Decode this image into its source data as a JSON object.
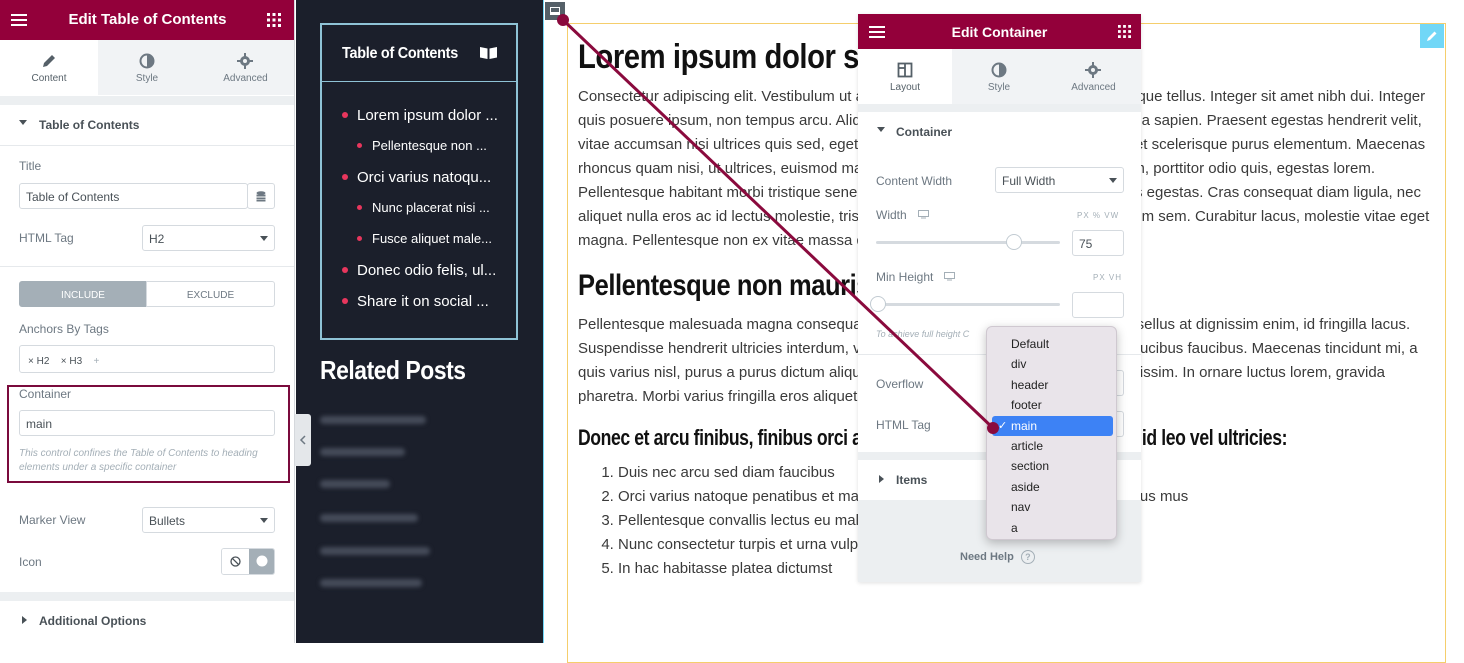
{
  "left_panel": {
    "title": "Edit Table of Contents",
    "tabs": [
      {
        "label": "Content",
        "icon": "pencil-icon"
      },
      {
        "label": "Style",
        "icon": "half-circle-icon"
      },
      {
        "label": "Advanced",
        "icon": "gear-icon"
      }
    ],
    "section_toc": "Table of Contents",
    "title_label": "Title",
    "title_value": "Table of Contents",
    "html_tag_label": "HTML Tag",
    "html_tag_value": "H2",
    "include_label": "INCLUDE",
    "exclude_label": "EXCLUDE",
    "anchors_label": "Anchors By Tags",
    "anchors_tags": [
      "H2",
      "H3"
    ],
    "container_label": "Container",
    "container_value": "main",
    "container_help": "This control confines the Table of Contents to heading elements under a specific container",
    "marker_view_label": "Marker View",
    "marker_view_value": "Bullets",
    "icon_label": "Icon",
    "additional_options": "Additional Options"
  },
  "preview_sidebar": {
    "toc_title": "Table of Contents",
    "toc_items": [
      {
        "text": "Lorem ipsum dolor ...",
        "level": 1
      },
      {
        "text": "Pellentesque non ...",
        "level": 2
      },
      {
        "text": "Orci varius natoqu...",
        "level": 1
      },
      {
        "text": "Nunc placerat nisi ...",
        "level": 2
      },
      {
        "text": "Fusce aliquet male...",
        "level": 2
      },
      {
        "text": "Donec odio felis, ul...",
        "level": 1
      },
      {
        "text": "Share it on social ...",
        "level": 1
      }
    ],
    "related_title": "Related Posts"
  },
  "content": {
    "h1": "Lorem ipsum dolor sit",
    "p1": "Consectetur adipiscing elit. Vestibulum ut ante nisi. Pellentesque habitant morbi tristique tellus. Integer sit amet nibh dui. Integer quis posuere ipsum, non tempus arcu. Aliquam mollis massa, semper ipsum, in lacinia sapien. Praesent egestas hendrerit velit, vitae accumsan nisi ultrices quis sed, eget tempus mauris, eget nibh interdum, laoreet scelerisque purus elementum. Maecenas rhoncus quam nisi, ut ultrices, euismod maximus quis. Morbi sit amet velit elementum, porttitor odio quis, egestas lorem. Pellentesque habitant morbi tristique senectus et netus et malesuada fames ac turpis egestas. Cras consequat diam ligula, nec aliquet nulla eros ac id lectus molestie, tristique ex sed, volutpat mi. Praesent at dictum sem. Curabitur lacus, molestie vitae eget magna. Pellentesque non ex vitae massa dictum fermentum.",
    "h2": "Pellentesque non mauris",
    "p2": "Pellentesque malesuada magna consequat sed. Etiam erat turpis, feugiat nunc. Phasellus at dignissim enim, id fringilla lacus. Suspendisse hendrerit ultricies interdum, vel pretium. Sed dignissim sapien lacinia faucibus faucibus. Maecenas tincidunt mi, a quis varius nisl, purus a purus dictum aliquam. Etiam molestie molestie lectus id dignissim. In ornare luctus lorem, gravida pharetra. Morbi varius fringilla eros aliquet rhoncus.",
    "h3": "Donec et arcu finibus, finibus orci at, lacinia mauris. Fusce fermentum id leo vel ultricies:",
    "list": [
      "Duis nec arcu sed diam faucibus",
      "Orci varius natoque penatibus et magnis dis parturient montes, nascetur ridiculus mus",
      "Pellentesque convallis lectus eu malesuada porttitor",
      "Nunc consectetur turpis et urna vulputate iaculis",
      "In hac habitasse platea dictumst"
    ]
  },
  "edit_container": {
    "title": "Edit Container",
    "tabs": [
      {
        "label": "Layout",
        "icon": "layout-icon"
      },
      {
        "label": "Style",
        "icon": "half-circle-icon"
      },
      {
        "label": "Advanced",
        "icon": "gear-icon"
      }
    ],
    "section": "Container",
    "content_width_label": "Content Width",
    "content_width_value": "Full Width",
    "width_label": "Width",
    "width_units": "PX  %  VW",
    "width_value": "75",
    "width_slider_fraction": 0.75,
    "min_height_label": "Min Height",
    "min_height_units": "PX  VH",
    "min_height_value": "",
    "min_height_help": "To achieve full height C",
    "overflow_label": "Overflow",
    "html_tag_label": "HTML Tag",
    "items_label": "Items",
    "need_help": "Need Help"
  },
  "dropdown": {
    "options": [
      "Default",
      "div",
      "header",
      "footer",
      "main",
      "article",
      "section",
      "aside",
      "nav",
      "a"
    ],
    "selected": "main"
  },
  "colors": {
    "brand": "#93003a",
    "bullet": "#e8365d",
    "selected": "#3d82f5"
  }
}
